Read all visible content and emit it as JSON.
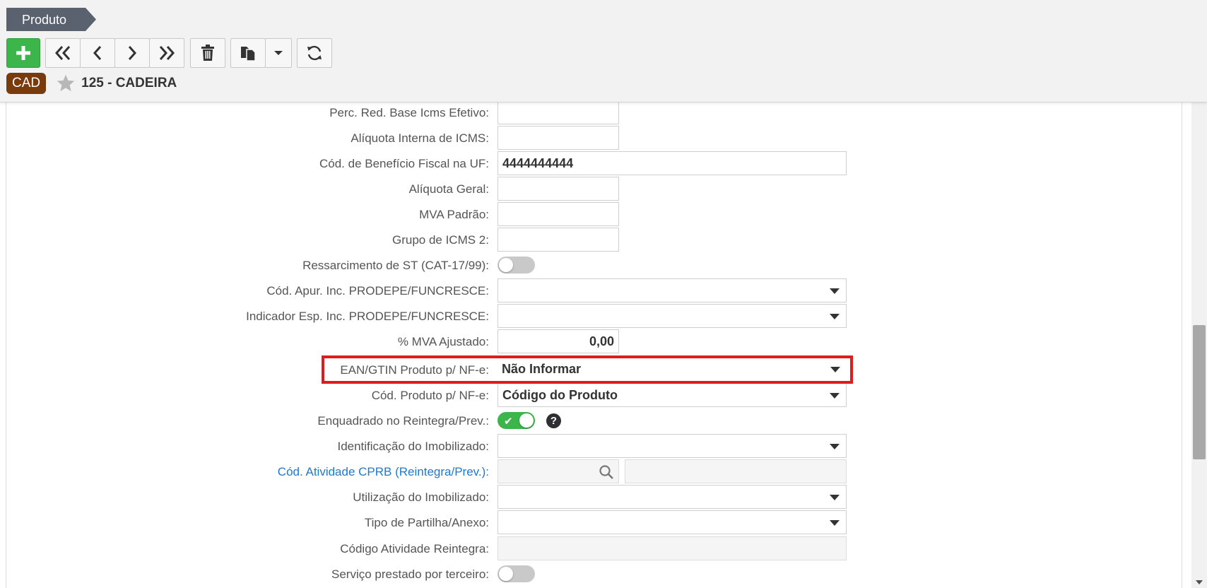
{
  "breadcrumb": {
    "label": "Produto"
  },
  "toolbar": {
    "buttons": [
      "add",
      "first",
      "previous",
      "next",
      "last",
      "delete",
      "copy",
      "copy-options",
      "refresh"
    ]
  },
  "record": {
    "badge": "CAD",
    "title": "125 - CADEIRA"
  },
  "form": {
    "perc_red_base_icms_efetivo": {
      "label": "Perc. Red. Base Icms Efetivo:",
      "value": ""
    },
    "aliquota_interna_icms": {
      "label": "Alíquota Interna de ICMS:",
      "value": ""
    },
    "cod_beneficio_fiscal_uf": {
      "label": "Cód. de Benefício Fiscal na UF:",
      "value": "4444444444"
    },
    "aliquota_geral": {
      "label": "Alíquota Geral:",
      "value": ""
    },
    "mva_padrao": {
      "label": "MVA Padrão:",
      "value": ""
    },
    "grupo_icms_2": {
      "label": "Grupo de ICMS 2:",
      "value": ""
    },
    "ressarcimento_st": {
      "label": "Ressarcimento de ST (CAT-17/99):",
      "checked": false
    },
    "cod_apur_prodepe": {
      "label": "Cód. Apur. Inc. PRODEPE/FUNCRESCE:",
      "value": ""
    },
    "indicador_esp_prodepe": {
      "label": "Indicador Esp. Inc. PRODEPE/FUNCRESCE:",
      "value": ""
    },
    "mva_ajustado": {
      "label": "% MVA Ajustado:",
      "value": "0,00"
    },
    "ean_gtin_nfe": {
      "label": "EAN/GTIN Produto p/ NF-e:",
      "value": "Não Informar"
    },
    "cod_produto_nfe": {
      "label": "Cód. Produto p/ NF-e:",
      "value": "Código do Produto"
    },
    "enquadrado_reintegra": {
      "label": "Enquadrado no Reintegra/Prev.:",
      "checked": true,
      "help": "?"
    },
    "identificacao_imobilizado": {
      "label": "Identificação do Imobilizado:",
      "value": ""
    },
    "cod_atividade_cprb": {
      "label": "Cód. Atividade CPRB (Reintegra/Prev.):",
      "value": "",
      "description": ""
    },
    "utilizacao_imobilizado": {
      "label": "Utilização do Imobilizado:",
      "value": ""
    },
    "tipo_partilha_anexo": {
      "label": "Tipo de Partilha/Anexo:",
      "value": ""
    },
    "codigo_atividade_reintegra": {
      "label": "Código Atividade Reintegra:",
      "value": ""
    },
    "servico_prestado_terceiro": {
      "label": "Serviço prestado por terceiro:",
      "checked": false
    }
  },
  "colors": {
    "add_button": "#3cb54a",
    "badge": "#7a3b0c",
    "breadcrumb": "#5a6270",
    "highlight": "#e11b1b",
    "link_label": "#1f78d1"
  }
}
